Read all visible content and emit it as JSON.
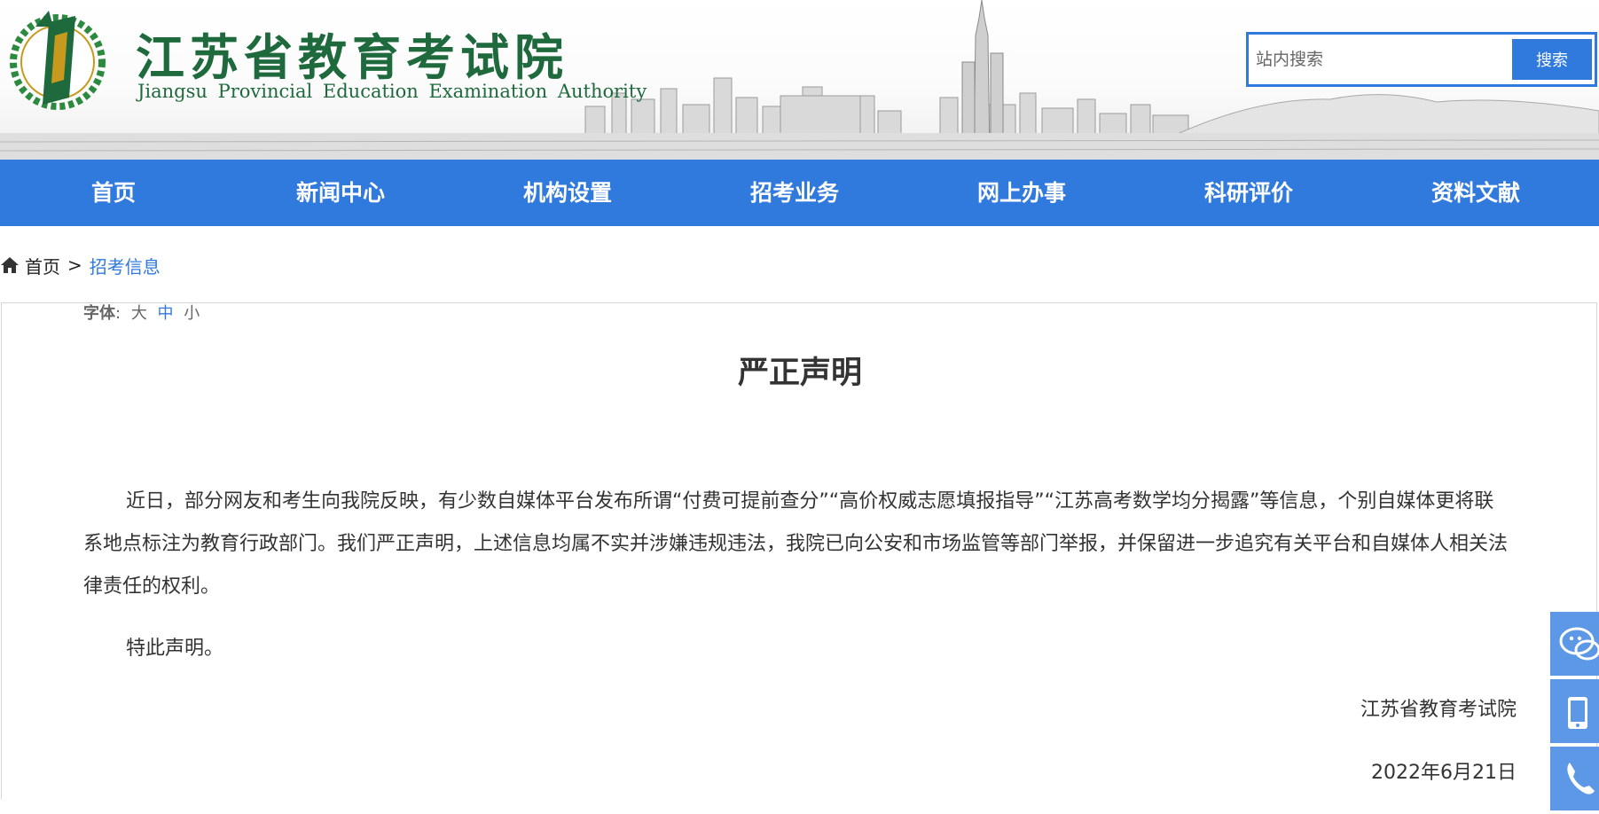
{
  "header": {
    "title_cn": "江苏省教育考试院",
    "title_en": "Jiangsu Provincial Education Examination Authority",
    "logo_icon": "jspeea-laurel-logo-icon"
  },
  "search": {
    "placeholder": "站内搜索",
    "button_label": "搜索"
  },
  "nav": {
    "items": [
      "首页",
      "新闻中心",
      "机构设置",
      "招考业务",
      "网上办事",
      "科研评价",
      "资料文献"
    ]
  },
  "breadcrumb": {
    "home": "首页",
    "separator": ">",
    "current": "招考信息"
  },
  "font_size": {
    "label": "字体",
    "colon": ":",
    "options": [
      "大",
      "中",
      "小"
    ],
    "active": "中"
  },
  "article": {
    "title": "严正声明",
    "paragraphs": [
      "近日，部分网友和考生向我院反映，有少数自媒体平台发布所谓“付费可提前查分”“高价权威志愿填报指导”“江苏高考数学均分揭露”等信息，个别自媒体更将联系地点标注为教育行政部门。我们严正声明，上述信息均属不实并涉嫌违规违法，我院已向公安和市场监管等部门举报，并保留进一步追究有关平台和自媒体人相关法律责任的权利。",
      "特此声明。"
    ],
    "signature_org": "江苏省教育考试院",
    "signature_date": "2022年6月21日"
  },
  "floating_bar": {
    "icons": [
      "wechat-icon",
      "mobile-icon",
      "phone-icon"
    ]
  },
  "colors": {
    "brand_green": "#1e6a3d",
    "accent_blue": "#3079dd",
    "float_blue": "#5c98e6"
  }
}
